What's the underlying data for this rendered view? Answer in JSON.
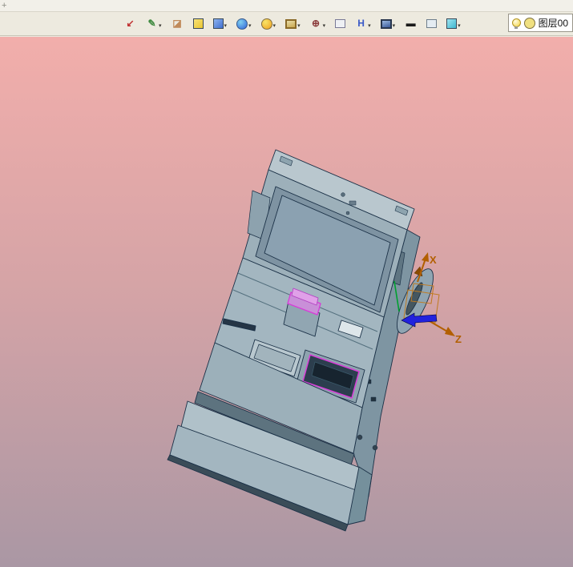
{
  "window": {
    "dock_handle": "+"
  },
  "toolbar": {
    "caret": "▾",
    "items": [
      {
        "name": "exit-render-icon",
        "shape": "glyph",
        "glyph": "↙",
        "color": "#c03030",
        "dropdown": false
      },
      {
        "name": "material-brush-icon",
        "shape": "glyph",
        "glyph": "✎",
        "color": "#3f8a3f",
        "dropdown": true
      },
      {
        "name": "eraser-icon",
        "shape": "glyph",
        "glyph": "◪",
        "color": "#c08a5a",
        "dropdown": false
      },
      {
        "name": "yellow-box-icon",
        "shape": "cube",
        "color": "#e9c52f",
        "color2": "#f7e27a",
        "dropdown": false
      },
      {
        "name": "blue-box-icon",
        "shape": "cube",
        "color": "#3f6fd0",
        "color2": "#8fb4ef",
        "dropdown": true
      },
      {
        "name": "blue-sphere-icon",
        "shape": "ball",
        "color": "#2f62d8",
        "color2": "#7fd0f0",
        "dropdown": true
      },
      {
        "name": "orange-sphere-icon",
        "shape": "ball",
        "color": "#efa01f",
        "color2": "#f8e468",
        "dropdown": true
      },
      {
        "name": "picture-icon",
        "shape": "frame",
        "color": "#caa84f",
        "color2": "#e8dca8",
        "border": "#8a6a28",
        "dropdown": true
      },
      {
        "name": "target-icon",
        "shape": "glyph",
        "glyph": "⊕",
        "color": "#8a3a3a",
        "dropdown": true
      },
      {
        "name": "window-icon",
        "shape": "rect",
        "color": "#eef0f4",
        "color2": "#7a7a96",
        "dropdown": false
      },
      {
        "name": "h-beam-icon",
        "shape": "glyph",
        "glyph": "H",
        "color": "#3a5ac8",
        "dropdown": true
      },
      {
        "name": "display-icon",
        "shape": "frame",
        "color": "#3a5a9a",
        "color2": "#9ab8e0",
        "border": "#28364e",
        "dropdown": true
      },
      {
        "name": "line-icon",
        "shape": "glyph",
        "glyph": "▬",
        "color": "#1a1a1a",
        "dropdown": false
      },
      {
        "name": "plane-icon",
        "shape": "rect",
        "color": "#e4ecf2",
        "color2": "#6e7e8c",
        "dropdown": false
      },
      {
        "name": "cyan-box-icon",
        "shape": "cube",
        "color": "#3fb8cf",
        "color2": "#9fe4f0",
        "dropdown": true
      }
    ]
  },
  "layer_panel": {
    "bulb_icon": "lightbulb-icon",
    "swatch_color": "#f0e080",
    "label": "图层00"
  },
  "viewport": {
    "background_top": "#f2aeab",
    "background_mid": "#d3a3a6",
    "background_bottom": "#aa97a4",
    "axes": {
      "x_label": "X",
      "z_label": "Z",
      "axis_color": "#b25f00",
      "y_arrow_color": "#2222dd",
      "y_axis_color": "#00a030"
    }
  },
  "model": {
    "name": "self-service kiosk 3D model",
    "body_color": "#a7bac4",
    "side_color": "#7e95a2",
    "outline_color": "#1b3147",
    "accent_magenta": "#d840d8",
    "screen_color": "#8ba1b1"
  }
}
